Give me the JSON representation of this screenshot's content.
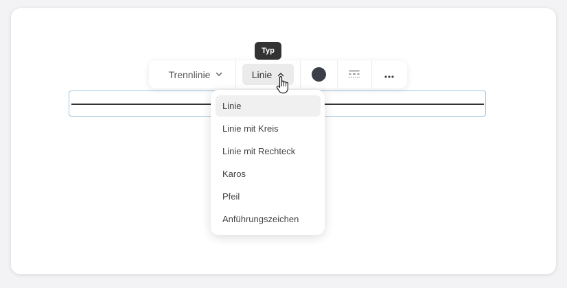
{
  "tooltip": {
    "label": "Typ"
  },
  "toolbar": {
    "style_label": "Trennlinie",
    "type_label": "Linie",
    "color_value": "#3a3e48"
  },
  "menu": {
    "items": [
      {
        "label": "Linie",
        "selected": true
      },
      {
        "label": "Linie mit Kreis",
        "selected": false
      },
      {
        "label": "Linie mit Rechteck",
        "selected": false
      },
      {
        "label": "Karos",
        "selected": false
      },
      {
        "label": "Pfeil",
        "selected": false
      },
      {
        "label": "Anführungszeichen",
        "selected": false
      }
    ]
  },
  "icons": {
    "style_chevron": "chevron-down-icon",
    "type_chevron": "chevron-up-icon",
    "line_style": "line-style-icon",
    "more": "more-horizontal-icon",
    "cursor": "hand-pointer-cursor-icon"
  }
}
